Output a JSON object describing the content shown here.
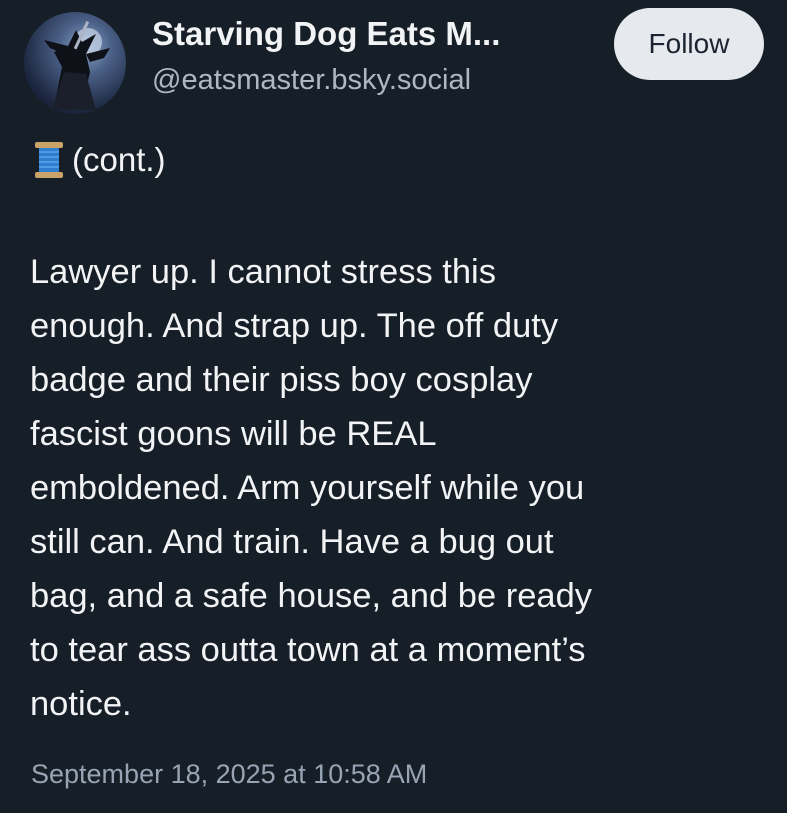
{
  "post": {
    "author": {
      "display_name": "Starving Dog Eats M...",
      "handle": "@eatsmaster.bsky.social",
      "avatar_icon": "avatar-image"
    },
    "follow_label": "Follow",
    "thread_icon": "spool-of-thread-icon",
    "thread_marker": "(cont.)",
    "body_lines": [
      "Lawyer up. I cannot stress this",
      "enough. And strap up. The off duty",
      "badge and their piss boy cosplay",
      "fascist goons will be REAL",
      "emboldened. Arm yourself while you",
      "still can. And train. Have a bug out",
      "bag, and a safe house, and be ready",
      "to tear ass outta town at a moment’s",
      "notice."
    ],
    "timestamp": "September 18, 2025 at 10:58 AM"
  },
  "colors": {
    "background": "#161e27",
    "text": "#f1f3f5",
    "handle": "#aeb8c5",
    "timestamp": "#98a4b3",
    "follow_bg": "#e6e9ee",
    "follow_text": "#1b2430"
  }
}
